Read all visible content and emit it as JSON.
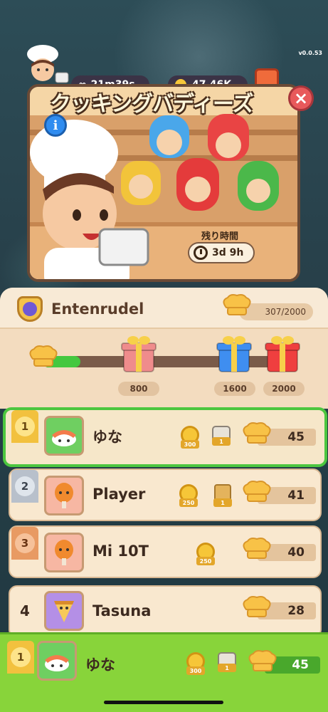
{
  "version": "v0.0.53",
  "hud": {
    "timer": "21m39s",
    "coins": "47.46K"
  },
  "event": {
    "title": "クッキングバディーズ",
    "timer_label": "残り時間",
    "timer_value": "3d 9h",
    "close_icon": "close-icon",
    "info_label": "i"
  },
  "team": {
    "name": "Entenrudel",
    "score": "307/2000",
    "progress": 0.1535,
    "milestones": [
      {
        "value": "800",
        "gift_color": "#ef8c8c"
      },
      {
        "value": "1600",
        "gift_color": "#3f8ef0"
      },
      {
        "value": "2000",
        "gift_color": "#ef3f3f"
      }
    ]
  },
  "leaderboard": [
    {
      "rank": "1",
      "name": "ゆな",
      "coin_reward": "300",
      "item_reward": "1",
      "item_icon": "lunchbox-icon",
      "score": "45",
      "ribbon": "gold"
    },
    {
      "rank": "2",
      "name": "Player",
      "coin_reward": "250",
      "item_reward": "1",
      "item_icon": "bag-icon",
      "score": "41",
      "ribbon": "silver"
    },
    {
      "rank": "3",
      "name": "Mi 10T",
      "coin_reward": "250",
      "item_reward": "",
      "item_icon": "",
      "score": "40",
      "ribbon": "bronze"
    },
    {
      "rank": "4",
      "name": "Tasuna",
      "coin_reward": "",
      "item_reward": "",
      "item_icon": "",
      "score": "28",
      "ribbon": "none"
    }
  ],
  "my_rank": {
    "rank": "1",
    "name": "ゆな",
    "coin_reward": "300",
    "item_reward": "1",
    "score": "45"
  },
  "colors": {
    "accent_green": "#4cc63f",
    "gold": "#f3c34a",
    "panel": "#f3dcbf"
  }
}
